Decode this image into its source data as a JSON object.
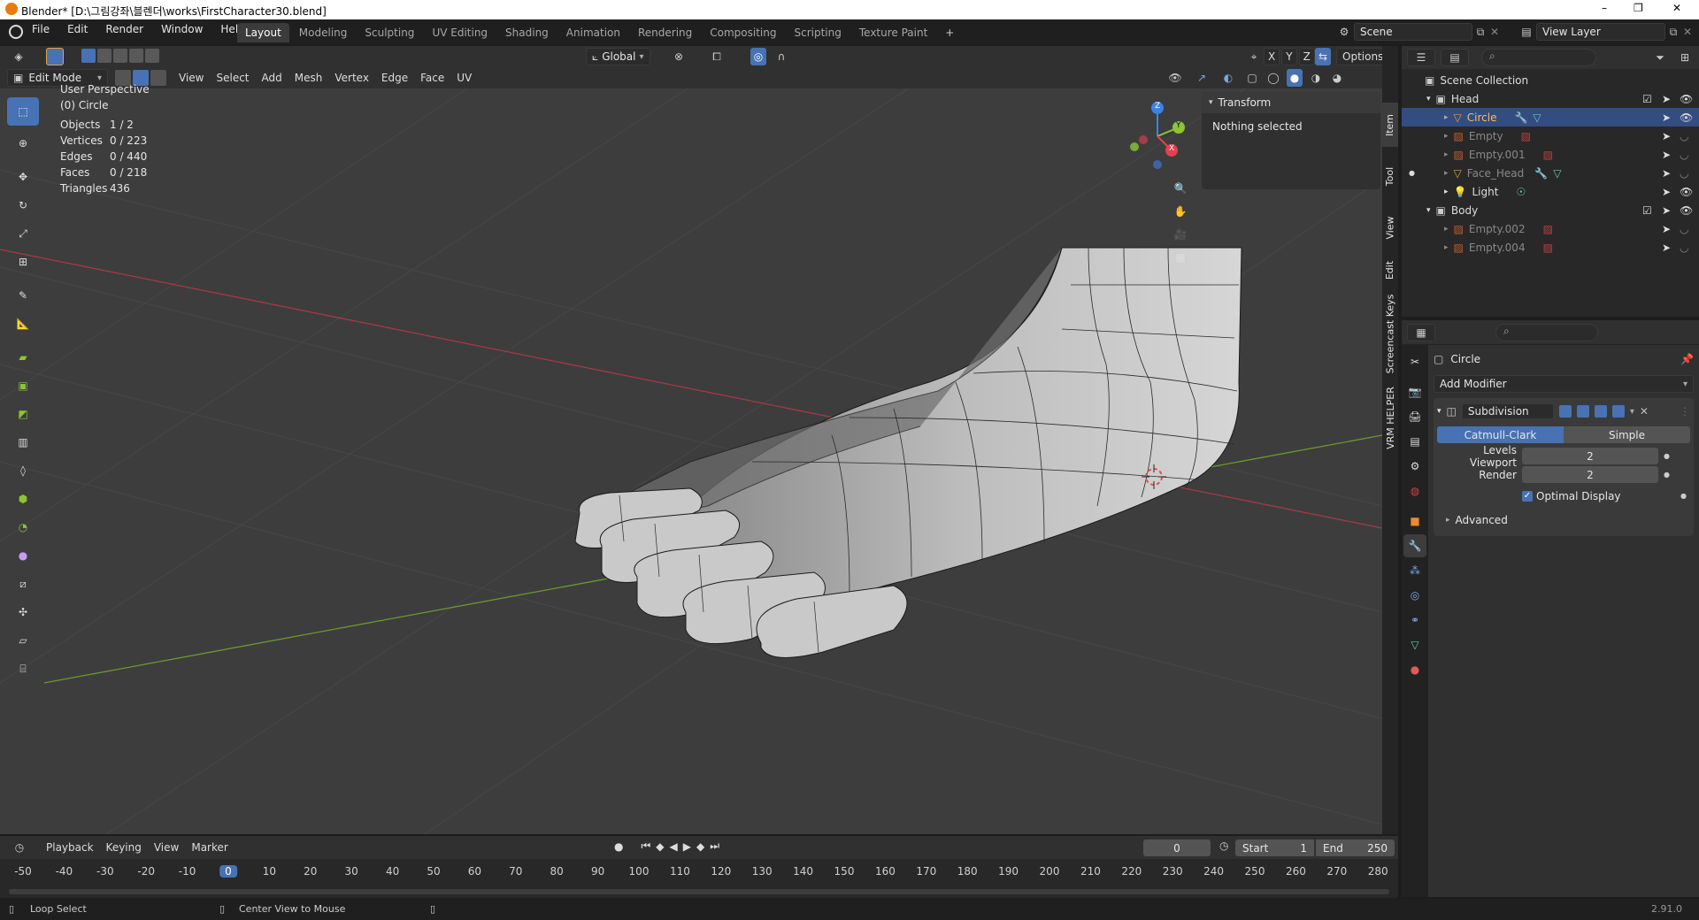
{
  "window": {
    "title": "Blender* [D:\\그림강좌\\블렌더\\works\\FirstCharacter30.blend]",
    "controls": [
      "–",
      "❐",
      "✕"
    ]
  },
  "menu": {
    "items": [
      "File",
      "Edit",
      "Render",
      "Window",
      "Help"
    ],
    "workspaces": [
      "Layout",
      "Modeling",
      "Sculpting",
      "UV Editing",
      "Shading",
      "Animation",
      "Rendering",
      "Compositing",
      "Scripting",
      "Texture Paint"
    ],
    "add_tab": "+",
    "scene": "Scene",
    "view_layer": "View Layer"
  },
  "viewport": {
    "mode": "Edit Mode",
    "menus": [
      "View",
      "Select",
      "Add",
      "Mesh",
      "Vertex",
      "Edge",
      "Face",
      "UV"
    ],
    "orientation": "Global",
    "axes": [
      "X",
      "Y",
      "Z"
    ],
    "options": "Options",
    "perspective": "User Perspective",
    "object_name": "(0) Circle",
    "stats": [
      {
        "label": "Objects",
        "value": "1 / 2"
      },
      {
        "label": "Vertices",
        "value": "0 / 223"
      },
      {
        "label": "Edges",
        "value": "0 / 440"
      },
      {
        "label": "Faces",
        "value": "0 / 218"
      },
      {
        "label": "Triangles",
        "value": "436"
      }
    ],
    "gizmo": {
      "x": "X",
      "y": "Y",
      "z": "Z"
    }
  },
  "npanel": {
    "section": "Transform",
    "message": "Nothing selected",
    "tabs": [
      "Item",
      "Tool",
      "View",
      "Edit",
      "Screencast Keys",
      "VRM HELPER"
    ]
  },
  "outliner": {
    "root": "Scene Collection",
    "rows": [
      {
        "name": "Head",
        "kind": "collection"
      },
      {
        "name": "Circle",
        "kind": "mesh"
      },
      {
        "name": "Empty",
        "kind": "empty"
      },
      {
        "name": "Empty.001",
        "kind": "empty"
      },
      {
        "name": "Face_Head",
        "kind": "mesh"
      },
      {
        "name": "Light",
        "kind": "light"
      },
      {
        "name": "Body",
        "kind": "collection"
      },
      {
        "name": "Empty.002",
        "kind": "empty"
      },
      {
        "name": "Empty.004",
        "kind": "empty"
      }
    ]
  },
  "properties": {
    "object": "Circle",
    "add_modifier": "Add Modifier",
    "modifier_name": "Subdivision",
    "catmull": "Catmull-Clark",
    "simple": "Simple",
    "levels_label": "Levels Viewport",
    "levels_value": "2",
    "render_label": "Render",
    "render_value": "2",
    "optimal": "Optimal Display",
    "advanced": "Advanced"
  },
  "timeline": {
    "menus": [
      "Playback",
      "Keying",
      "View",
      "Marker"
    ],
    "current_frame": "0",
    "start_label": "Start",
    "start": "1",
    "end_label": "End",
    "end": "250",
    "ticks": [
      "-50",
      "-40",
      "-30",
      "-20",
      "-10",
      "0",
      "10",
      "20",
      "30",
      "40",
      "50",
      "60",
      "70",
      "80",
      "90",
      "100",
      "110",
      "120",
      "130",
      "140",
      "150",
      "160",
      "170",
      "180",
      "190",
      "200",
      "210",
      "220",
      "230",
      "240",
      "250",
      "260",
      "270",
      "280"
    ]
  },
  "status": {
    "left": "Loop Select",
    "middle": "Center View to Mouse",
    "version": "2.91.0"
  },
  "colors": {
    "accent": "#4772b3",
    "x_axis": "#e6404f",
    "y_axis": "#8bc534",
    "z_axis": "#3b82e8"
  }
}
